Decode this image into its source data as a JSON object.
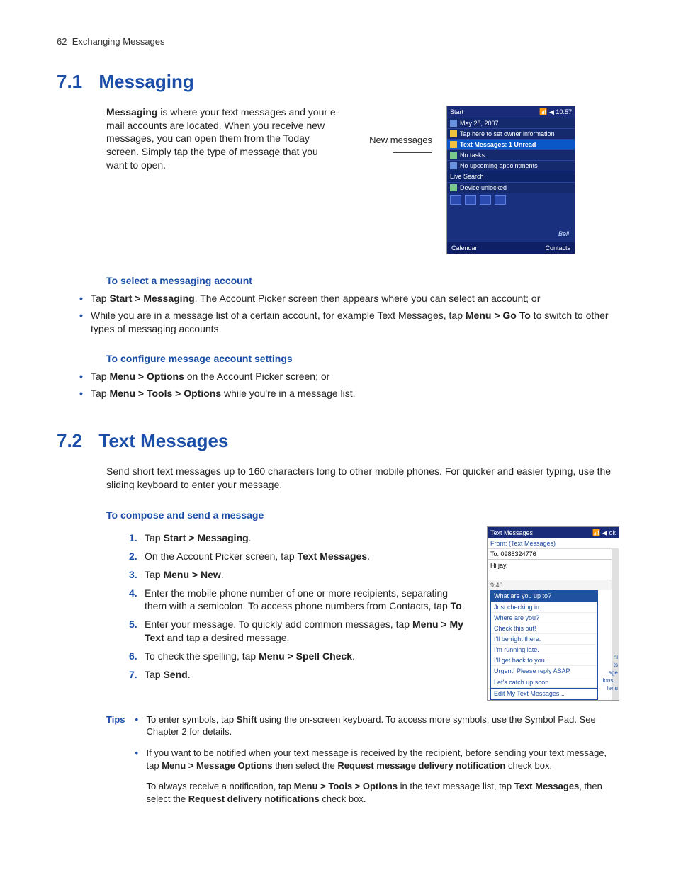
{
  "header": {
    "page_no": "62",
    "section": "Exchanging Messages"
  },
  "s71": {
    "num": "7.1",
    "title": "Messaging",
    "intro_html": "<b>Messaging</b> is where your text messages and your e-mail accounts are located. When you receive new messages, you can open them from the Today screen. Simply tap the type of message that you want to open.",
    "callout": "New messages",
    "phone": {
      "title_left": "Start",
      "title_right": "10:57",
      "rows": [
        "May 28, 2007",
        "Tap here to set owner information",
        "Text Messages: 1 Unread",
        "No tasks",
        "No upcoming appointments",
        "Live Search",
        "Device unlocked"
      ],
      "logo": "Bell",
      "soft_left": "Calendar",
      "soft_right": "Contacts"
    },
    "h_select": "To select a messaging account",
    "select_items": [
      "Tap <b>Start > Messaging</b>. The Account Picker screen then appears where you can select an account; or",
      "While you are in a message list of a certain account, for example Text Messages, tap <b>Menu > Go To</b> to switch to other types of messaging accounts."
    ],
    "h_config": "To configure message account settings",
    "config_items": [
      "Tap <b>Menu > Options</b> on the Account Picker screen; or",
      "Tap <b>Menu > Tools > Options</b> while you're in a message list."
    ]
  },
  "s72": {
    "num": "7.2",
    "title": "Text Messages",
    "intro": "Send short text messages up to 160 characters long to other mobile phones. For quicker and easier typing, use the sliding keyboard to enter your message.",
    "h_compose": "To compose and send a message",
    "steps": [
      "Tap <b>Start > Messaging</b>.",
      "On the Account Picker screen, tap <b>Text Messages</b>.",
      "Tap <b>Menu > New</b>.",
      "Enter the mobile phone number of one or more recipients, separating them with a semicolon. To access phone numbers from Contacts, tap <b>To</b>.",
      "Enter your message. To quickly add common messages, tap <b>Menu > My Text</b> and tap a desired message.",
      "To check the spelling, tap <b>Menu > Spell Check</b>.",
      "Tap <b>Send</b>."
    ],
    "phone": {
      "title_left": "Text Messages",
      "title_right": "ok",
      "from": "From: (Text Messages)",
      "to_label": "To:",
      "to_val": "0988324776",
      "msg": "Hi jay,",
      "time": "9:40",
      "popup": [
        "What are you up to?",
        "Just checking in...",
        "Where are you?",
        "Check this out!",
        "I'll be right there.",
        "I'm running late.",
        "I'll get back to you.",
        "Urgent! Please reply ASAP.",
        "Let's catch up soon."
      ],
      "popup_edit": "Edit My Text Messages...",
      "side": [
        "hi",
        "ts",
        "age",
        "tions...",
        "lenu"
      ]
    },
    "tips_label": "Tips",
    "tips": [
      "To enter symbols, tap <b>Shift</b> using the on-screen keyboard. To access more symbols, use the Symbol Pad. See Chapter 2 for details.",
      "If you want to be notified when your text message is received by the recipient, before sending your text message, tap <b>Menu > Message Options</b> then select the <b>Request message delivery notification</b> check box."
    ],
    "tips_follow": "To always receive a notification, tap <b>Menu > Tools > Options</b> in the text message list, tap <b>Text Messages</b>, then select the <b>Request delivery notifications</b> check box."
  }
}
